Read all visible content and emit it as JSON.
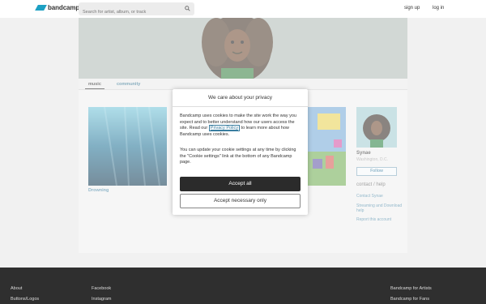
{
  "header": {
    "logo_text": "bandcamp",
    "search_placeholder": "Search for artist, album, or track",
    "signup": "sign up",
    "login": "log in"
  },
  "tabs": {
    "music": "music",
    "community": "community"
  },
  "albums": [
    {
      "title": "Drowning"
    }
  ],
  "artist": {
    "name": "Synae",
    "location": "Washington, D.C.",
    "follow": "Follow",
    "contact_heading": "contact / help",
    "links": [
      "Contact Synae",
      "Streaming and Download help",
      "Report this account"
    ]
  },
  "cookie_modal": {
    "title": "We care about your privacy",
    "body_before_link": "Bandcamp uses cookies to make the site work the way you expect and to better understand how our users access the site. Read our ",
    "link_text": "Privacy Policy",
    "body_after_link": " to learn more about how Bandcamp uses cookies.",
    "body2": "You can update your cookie settings at any time by clicking the \"Cookie settings\" link at the bottom of any Bandcamp page.",
    "accept_all": "Accept all",
    "accept_necessary": "Accept necessary only"
  },
  "footer": {
    "col1": [
      "About",
      "Buttons/Logos"
    ],
    "col2": [
      "Facebook",
      "Instagram"
    ],
    "col3": [
      "Bandcamp for Artists",
      "Bandcamp for Fans"
    ]
  },
  "colors": {
    "brand": "#1da0c3",
    "link": "#3a7ea0",
    "footer_bg": "#2f2f2f"
  }
}
